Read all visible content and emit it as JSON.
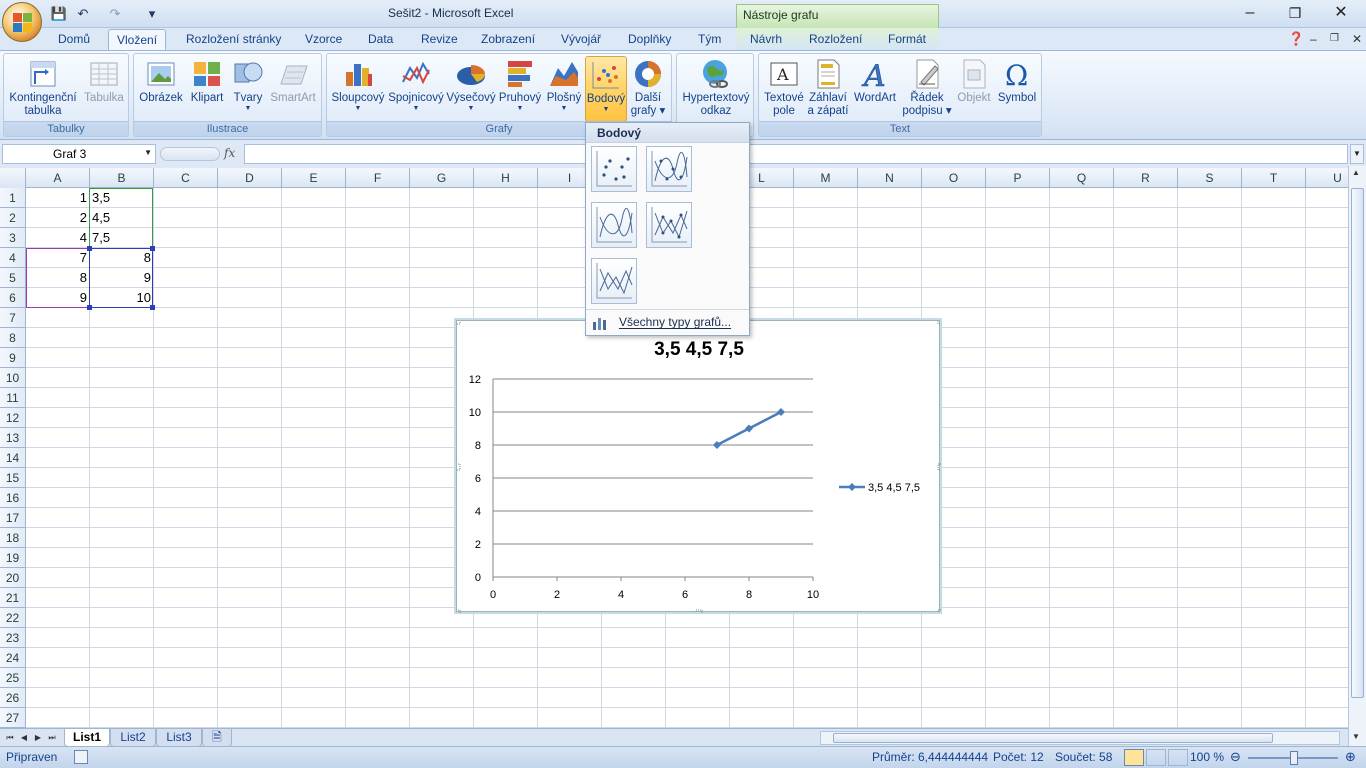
{
  "window": {
    "title": "Sešit2 - Microsoft Excel",
    "contextual_title": "Nástroje grafu",
    "controls": {
      "minimize": "–",
      "restore": "❐",
      "close": "✕"
    }
  },
  "qat": {
    "save": "💾",
    "undo": "↶",
    "redo": "↷",
    "customize": "▾"
  },
  "tabs": [
    {
      "label": "Domů"
    },
    {
      "label": "Vložení"
    },
    {
      "label": "Rozložení stránky"
    },
    {
      "label": "Vzorce"
    },
    {
      "label": "Data"
    },
    {
      "label": "Revize"
    },
    {
      "label": "Zobrazení"
    },
    {
      "label": "Vývojář"
    },
    {
      "label": "Doplňky"
    },
    {
      "label": "Tým"
    },
    {
      "label": "Návrh"
    },
    {
      "label": "Rozložení"
    },
    {
      "label": "Formát"
    }
  ],
  "active_tab": "Vložení",
  "ribbon": {
    "groups": {
      "tabulky": "Tabulky",
      "ilustrace": "Ilustrace",
      "grafy": "Grafy",
      "text": "Text"
    },
    "buttons": {
      "kontingencni_1": "Kontingenční",
      "kontingencni_2": "tabulka",
      "tabulka": "Tabulka",
      "obrazek": "Obrázek",
      "klipart": "Klipart",
      "tvary": "Tvary",
      "smartart": "SmartArt",
      "sloupcovy": "Sloupcový",
      "spojnicovy": "Spojnicový",
      "vysecovy": "Výsečový",
      "pruhovy": "Pruhový",
      "plosny": "Plošný",
      "bodovy": "Bodový",
      "dalsi_1": "Další",
      "dalsi_2": "grafy",
      "hyper_1": "Hypertextový",
      "hyper_2": "odkaz",
      "textove_1": "Textové",
      "textove_2": "pole",
      "zahlavi_1": "Záhlaví",
      "zahlavi_2": "a zápatí",
      "wordart": "WordArt",
      "radek_1": "Řádek",
      "radek_2": "podpisu",
      "objekt": "Objekt",
      "symbol": "Symbol"
    }
  },
  "formula_bar": {
    "name_box": "Graf 3",
    "fx": "fx",
    "formula": ""
  },
  "columns": [
    "A",
    "B",
    "C",
    "D",
    "E",
    "F",
    "G",
    "H",
    "I",
    "J",
    "K",
    "L",
    "M",
    "N",
    "O",
    "P",
    "Q",
    "R",
    "S",
    "T",
    "U"
  ],
  "rows": [
    "1",
    "2",
    "3",
    "4",
    "5",
    "6",
    "7",
    "8",
    "9",
    "10",
    "11",
    "12",
    "13",
    "14",
    "15",
    "16",
    "17",
    "18",
    "19",
    "20",
    "21",
    "22",
    "23",
    "24",
    "25",
    "26",
    "27"
  ],
  "cells": [
    {
      "ref": "A1",
      "value": "1"
    },
    {
      "ref": "B1",
      "value": "3,5"
    },
    {
      "ref": "A2",
      "value": "2"
    },
    {
      "ref": "B2",
      "value": "4,5"
    },
    {
      "ref": "A3",
      "value": "4"
    },
    {
      "ref": "B3",
      "value": "7,5"
    },
    {
      "ref": "A4",
      "value": "7"
    },
    {
      "ref": "B4",
      "value": "8"
    },
    {
      "ref": "A5",
      "value": "8"
    },
    {
      "ref": "B5",
      "value": "9"
    },
    {
      "ref": "A6",
      "value": "9"
    },
    {
      "ref": "B6",
      "value": "10"
    }
  ],
  "gallery": {
    "title": "Bodový",
    "footer": "Všechny typy grafů..."
  },
  "chart_data": {
    "type": "line",
    "title": "3,5 4,5 7,5",
    "series": [
      {
        "name": "3,5 4,5 7,5",
        "x": [
          7,
          8,
          9
        ],
        "values": [
          8,
          9,
          10
        ],
        "color": "#4a7ebb"
      }
    ],
    "xlim": [
      0,
      10
    ],
    "ylim": [
      0,
      12
    ],
    "x_ticks": [
      "0",
      "2",
      "4",
      "6",
      "8",
      "10"
    ],
    "y_ticks": [
      "0",
      "2",
      "4",
      "6",
      "8",
      "10",
      "12"
    ],
    "grid": "horizontal",
    "legend": "right"
  },
  "sheets": [
    {
      "label": "List1"
    },
    {
      "label": "List2"
    },
    {
      "label": "List3"
    }
  ],
  "status": {
    "ready": "Připraven",
    "average": "Průměr: 6,444444444",
    "count": "Počet: 12",
    "sum": "Součet: 58",
    "zoom": "100 %"
  }
}
